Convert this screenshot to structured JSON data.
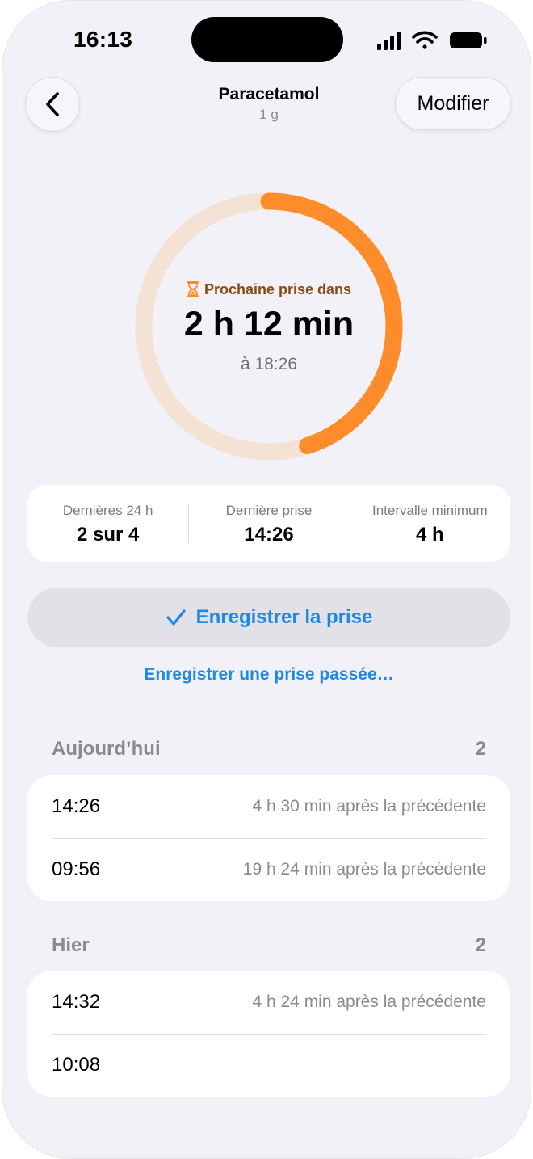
{
  "status_bar": {
    "time": "16:13"
  },
  "nav": {
    "title": "Paracetamol",
    "subtitle": "1 g",
    "edit_label": "Modifier"
  },
  "countdown": {
    "label": "Prochaine prise dans",
    "value": "2 h 12 min",
    "at_time": "à 18:26",
    "progress": 0.45,
    "colors": {
      "track": "#f4e2d4",
      "fill": "#ff8c2a"
    }
  },
  "stats": [
    {
      "label": "Dernières 24 h",
      "value": "2 sur 4"
    },
    {
      "label": "Dernière prise",
      "value": "14:26"
    },
    {
      "label": "Intervalle minimum",
      "value": "4 h"
    }
  ],
  "actions": {
    "log_label": "Enregistrer la prise",
    "past_label": "Enregistrer une prise passée…",
    "accent": "#1e88e5"
  },
  "sections": [
    {
      "title": "Aujourd’hui",
      "count": "2",
      "rows": [
        {
          "time": "14:26",
          "note": "4 h 30 min après la précédente"
        },
        {
          "time": "09:56",
          "note": "19 h 24 min après la précédente"
        }
      ]
    },
    {
      "title": "Hier",
      "count": "2",
      "rows": [
        {
          "time": "14:32",
          "note": "4 h 24 min après la précédente"
        },
        {
          "time": "10:08",
          "note": ""
        }
      ]
    }
  ]
}
